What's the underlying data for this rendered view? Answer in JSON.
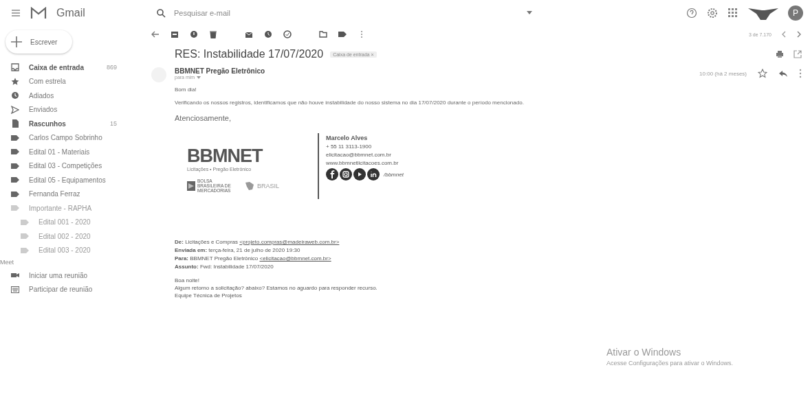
{
  "app": {
    "name": "Gmail"
  },
  "search": {
    "placeholder": "Pesquisar e-mail"
  },
  "header": {
    "avatar": "P"
  },
  "compose": {
    "label": "Escrever"
  },
  "sidebar": {
    "items": [
      {
        "label": "Caixa de entrada",
        "count": "869",
        "kind": "inbox",
        "bold": true,
        "selected": false
      },
      {
        "label": "Com estrela",
        "kind": "star",
        "bold": false,
        "selected": false
      },
      {
        "label": "Adiados",
        "kind": "clock",
        "bold": false,
        "selected": false
      },
      {
        "label": "Enviados",
        "kind": "send",
        "bold": false,
        "selected": false
      },
      {
        "label": "Rascunhos",
        "count": "15",
        "kind": "draft",
        "bold": true,
        "selected": false
      },
      {
        "label": "Carlos Campo Sobrinho",
        "kind": "label",
        "bold": false,
        "selected": false
      },
      {
        "label": "Edital 01 - Materiais",
        "kind": "label",
        "bold": false,
        "selected": false
      },
      {
        "label": "Edital 03 - Competições",
        "kind": "label",
        "bold": false,
        "selected": false
      },
      {
        "label": "Edital 05 - Equipamentos",
        "kind": "label",
        "bold": false,
        "selected": false
      },
      {
        "label": "Fernanda Ferraz",
        "kind": "label",
        "bold": false,
        "selected": false
      },
      {
        "label": "Importante - RAPHA",
        "kind": "faint",
        "bold": false,
        "selected": false,
        "children": [
          {
            "label": "Edital 001 - 2020",
            "kind": "faint",
            "bold": false,
            "selected": false
          },
          {
            "label": "Edital 002 - 2020",
            "kind": "faint",
            "bold": false,
            "selected": false
          },
          {
            "label": "Edital 003 - 2020",
            "kind": "faint",
            "bold": false,
            "selected": false
          }
        ]
      }
    ]
  },
  "meet": {
    "title": "Meet",
    "items": [
      {
        "label": "Iniciar uma reunião",
        "kind": "video"
      },
      {
        "label": "Participar de reunião",
        "kind": "keyboard"
      }
    ]
  },
  "toolbar": {
    "pager": "3 de 7.170"
  },
  "message": {
    "subject": "RES: Instabilidade 17/07/2020",
    "chip": "Caixa de entrada",
    "chip_close": "×",
    "sender": "BBMNET Pregão Eletrônico",
    "to": "para mim",
    "date": "10:00 (há 2 meses)",
    "starred": false,
    "greeting": "Bom dia!",
    "body": "Verificando os nossos registros, identificamos que não houve instabilidade do nosso sistema no dia 17/07/2020 durante o período mencionado.",
    "closing": "Atenciosamente,",
    "signature": {
      "logo": "BBMNET",
      "tagline": "Licitações • Pregão Eletrônico",
      "partner_1": "BOLSA BRASILEIRA DE MERCADORIAS",
      "partner_2": "BRASIL",
      "name": "Marcelo Alves",
      "phone": "+ 55 11 3113-1900",
      "email": "elicitacao@bbmnet.com.br",
      "site": "www.bbmnetlicitacoes.com.br",
      "social_handle": "/bbmnet"
    },
    "quoted": {
      "lines": [
        {
          "label": "De:",
          "text": "Licitações e Compras ",
          "link": "<projeto.compras@madeiraweb.com.br>"
        },
        {
          "label": "Enviada em:",
          "text": "terça-feira, 21 de julho de 2020 19:30"
        },
        {
          "label": "Para:",
          "text": "BBMNET Pregão Eletrônico ",
          "link": "<elicitacao@bbmnet.com.br>"
        },
        {
          "label": "Assunto:",
          "text": "Fwd: Instabilidade 17/07/2020"
        }
      ],
      "body": [
        "Boa noite!",
        "Algum retorno a solicitação? abaixo? Estamos no aguardo para responder recurso.",
        "Equipe Técnica de Projetos"
      ]
    }
  },
  "watermark_activation": {
    "title": "Ativar o Windows",
    "text": "Acesse Configurações para ativar o Windows."
  }
}
